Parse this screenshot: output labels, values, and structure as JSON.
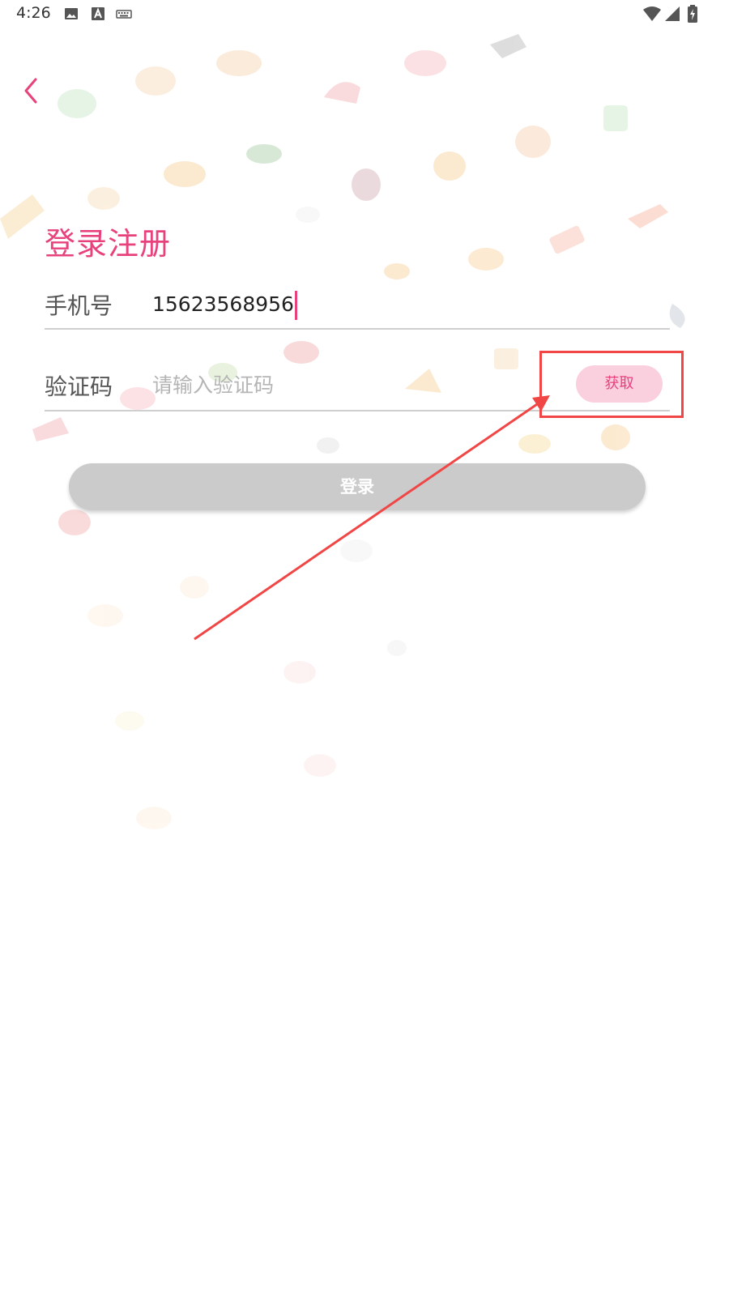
{
  "status_bar": {
    "time": "4:26",
    "left_icons": [
      "image-icon",
      "text-a-icon",
      "keyboard-icon"
    ],
    "right_icons": [
      "wifi-icon",
      "cell-signal-icon",
      "battery-charging-icon"
    ]
  },
  "header": {
    "back_icon": "chevron-left-icon"
  },
  "page": {
    "title": "登录注册"
  },
  "form": {
    "phone": {
      "label": "手机号",
      "value": "15623568956"
    },
    "code": {
      "label": "验证码",
      "placeholder": "请输入验证码",
      "value": "",
      "get_code_label": "获取"
    },
    "login_label": "登录"
  },
  "annotation": {
    "type": "highlight-box-with-arrow",
    "target": "get-code-button",
    "color": "#f04646"
  },
  "colors": {
    "accent": "#e8427c",
    "get_code_bg": "#fbd0de",
    "login_disabled_bg": "#cbcbcb",
    "annotation": "#f04646"
  }
}
